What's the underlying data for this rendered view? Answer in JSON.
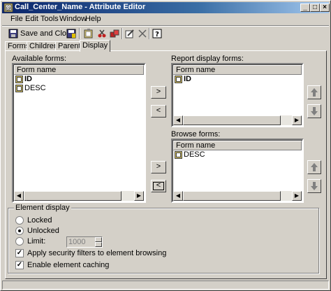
{
  "window": {
    "title": "Call_Center_Name - Attribute Editor",
    "title_icon": "attribute-icon",
    "controls": [
      "minimize-icon",
      "maximize-icon",
      "close-icon"
    ]
  },
  "menu": {
    "file": "File",
    "edit": "Edit",
    "tools": "Tools",
    "window": "Window",
    "help": "Help"
  },
  "toolbar": {
    "save_close_label": "Save and Close",
    "icons": [
      "save-icon",
      "save-close-icon",
      "properties-icon",
      "cut-icon",
      "copy-icon",
      "paste-icon",
      "edit-icon",
      "delete-icon",
      "help-icon"
    ]
  },
  "tabs": {
    "forms": "Forms",
    "children": "Children",
    "parents": "Parents",
    "display": "Display",
    "active": "Display"
  },
  "available_forms": {
    "label": "Available forms:",
    "column": "Form name",
    "items": [
      {
        "name": "ID",
        "bold": true
      },
      {
        "name": "DESC",
        "bold": false
      }
    ]
  },
  "report_display_forms": {
    "label": "Report display forms:",
    "column": "Form name",
    "items": [
      {
        "name": "ID",
        "bold": true
      }
    ]
  },
  "browse_forms": {
    "label": "Browse forms:",
    "column": "Form name",
    "items": [
      {
        "name": "DESC",
        "bold": false
      }
    ]
  },
  "move_buttons": {
    "add": ">",
    "remove": "<"
  },
  "element_display": {
    "title": "Element display",
    "locked": "Locked",
    "unlocked": "Unlocked",
    "limit": "Limit:",
    "limit_value": "1000",
    "selected": "Unlocked",
    "security_filters": "Apply security filters to element browsing",
    "security_filters_checked": true,
    "caching": "Enable element caching",
    "caching_checked": true
  }
}
